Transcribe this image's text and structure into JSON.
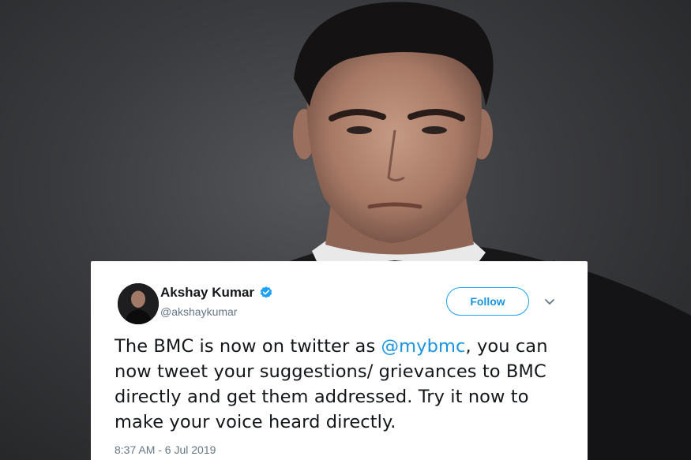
{
  "tweet": {
    "display_name": "Akshay Kumar",
    "handle": "@akshaykumar",
    "follow_label": "Follow",
    "text_part1": "The BMC is now on twitter as ",
    "mention": "@mybmc",
    "text_part2": ", you can now tweet your suggestions/ grievances to BMC directly and get them addressed. Try it now to make your voice heard directly.",
    "timestamp": "8:37 AM - 6 Jul 2019"
  },
  "colors": {
    "accent": "#1da1f2",
    "verified": "#1da1f2",
    "text": "#14171a",
    "muted": "#657786",
    "background": "#3a3b3e"
  },
  "icons": {
    "verified": "verified-badge-icon",
    "menu": "chevron-down-icon"
  }
}
